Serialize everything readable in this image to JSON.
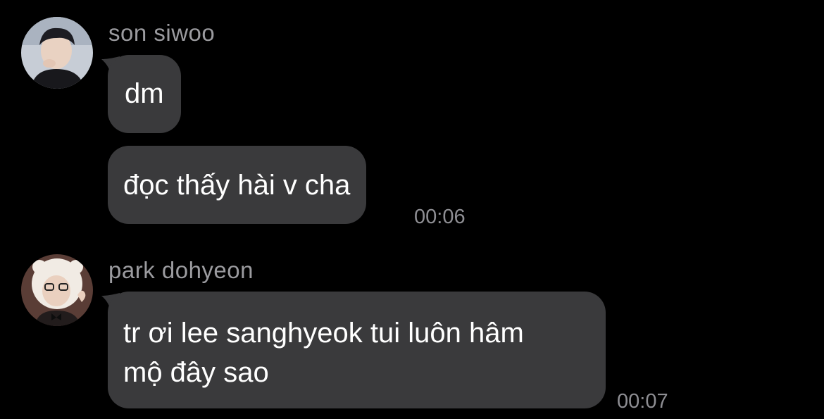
{
  "messages": [
    {
      "sender": "son siwoo",
      "avatar": "avatar-son-siwoo",
      "bubbles": [
        "dm",
        "đọc thấy hài v cha"
      ],
      "time": "00:06"
    },
    {
      "sender": "park dohyeon",
      "avatar": "avatar-park-dohyeon",
      "bubbles": [
        "tr ơi lee sanghyeok tui luôn hâm",
        "mộ đây sao"
      ],
      "time": "00:07"
    }
  ],
  "colors": {
    "background": "#000000",
    "bubble": "#3a3a3c",
    "sender_name": "#9b9b9f",
    "timestamp": "#8e8e93"
  }
}
